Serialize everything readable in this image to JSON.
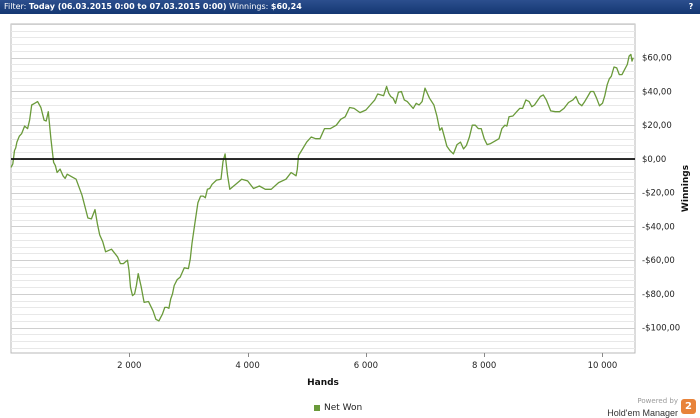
{
  "filter": {
    "label": "Filter:",
    "value": "Today (06.03.2015 0:00 to 07.03.2015 0:00)",
    "winnings_label": "Winnings:",
    "winnings_value": "$60,24",
    "help_icon": "help-icon"
  },
  "footer": {
    "legend_label": "Net Won",
    "powered_by": "Powered by",
    "brand": "Hold'em Manager",
    "brand_logo": "2"
  },
  "chart_data": {
    "type": "line",
    "title": "",
    "xlabel": "Hands",
    "ylabel": "Winnings",
    "xlim": [
      0,
      10550
    ],
    "ylim": [
      -115,
      80
    ],
    "x_ticks": [
      2000,
      4000,
      6000,
      8000,
      10000
    ],
    "x_tick_labels": [
      "2 000",
      "4 000",
      "6 000",
      "8 000",
      "10 000"
    ],
    "y_ticks": [
      60,
      40,
      20,
      0,
      -20,
      -40,
      -60,
      -80,
      -100
    ],
    "y_tick_labels": [
      "$60,00",
      "$40,00",
      "$20,00",
      "$0,00",
      "-$20,00",
      "-$40,00",
      "-$60,00",
      "-$80,00",
      "-$100,00"
    ],
    "grid": true,
    "zero_line": true,
    "legend_position": "bottom-center",
    "series_color": "#6a9a3a",
    "series": [
      {
        "name": "Net Won",
        "x": [
          0,
          60,
          100,
          180,
          280,
          350,
          450,
          560,
          630,
          720,
          780,
          880,
          950,
          1100,
          1300,
          1420,
          1500,
          1600,
          1800,
          1900,
          1970,
          2020,
          2090,
          2150,
          2250,
          2400,
          2500,
          2560,
          2640,
          2700,
          2760,
          2860,
          3000,
          3060,
          3160,
          3250,
          3320,
          3400,
          3550,
          3620,
          3700,
          3800,
          4000,
          4200,
          4400,
          4650,
          4820,
          4860,
          5000,
          5150,
          5300,
          5500,
          5650,
          5800,
          6000,
          6150,
          6250,
          6350,
          6420,
          6500,
          6600,
          6700,
          6800,
          6900,
          7000,
          7150,
          7250,
          7320,
          7420,
          7480,
          7600,
          7700,
          7800,
          7900,
          8000,
          8100,
          8250,
          8350,
          8420,
          8550,
          8650,
          8760,
          8850,
          8950,
          9050,
          9200,
          9350,
          9500,
          9600,
          9700,
          9800,
          9900,
          10000,
          10080,
          10150,
          10240,
          10330,
          10420,
          10480,
          10520
        ],
        "y": [
          -5,
          5,
          10,
          15,
          18,
          32,
          34,
          23,
          28,
          -2,
          -8,
          -10,
          -9,
          -12,
          -35,
          -30,
          -45,
          -55,
          -58,
          -62,
          -60,
          -76,
          -80,
          -68,
          -85,
          -90,
          -96,
          -92,
          -88,
          -83,
          -75,
          -70,
          -65,
          -50,
          -26,
          -22,
          -18,
          -15,
          -12,
          3,
          -18,
          -15,
          -13,
          -16,
          -18,
          -12,
          -10,
          2,
          10,
          12,
          18,
          20,
          25,
          30,
          29,
          35,
          38,
          43,
          37,
          33,
          40,
          34,
          30,
          32,
          42,
          32,
          17,
          14,
          5,
          3,
          10,
          8,
          20,
          18,
          12,
          9,
          12,
          20,
          25,
          28,
          30,
          34,
          32,
          37,
          35,
          28,
          30,
          35,
          33,
          34,
          40,
          36,
          33,
          44,
          49,
          54,
          50,
          56,
          62,
          60
        ]
      }
    ]
  }
}
